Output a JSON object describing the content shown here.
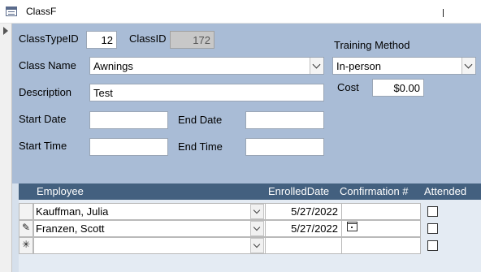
{
  "window": {
    "title": "ClassF"
  },
  "form": {
    "class_type_id_label": "ClassTypeID",
    "class_type_id_value": "12",
    "class_id_label": "ClassID",
    "class_id_value": "172",
    "class_name_label": "Class Name",
    "class_name_value": "Awnings",
    "description_label": "Description",
    "description_value": "Test",
    "start_date_label": "Start Date",
    "start_date_value": "",
    "end_date_label": "End Date",
    "end_date_value": "",
    "start_time_label": "Start Time",
    "start_time_value": "",
    "end_time_label": "End Time",
    "end_time_value": "",
    "training_method_label": "Training Method",
    "training_method_value": "In-person",
    "cost_label": "Cost",
    "cost_value": "$0.00"
  },
  "subform": {
    "columns": [
      "Employee",
      "EnrolledDate",
      "Confirmation #",
      "Attended"
    ],
    "rows": [
      {
        "selector": "",
        "employee": "Kauffman, Julia",
        "enrolled_date": "5/27/2022",
        "confirmation": "",
        "attended": false
      },
      {
        "selector": "✎",
        "employee": "Franzen, Scott",
        "enrolled_date": "5/27/2022",
        "confirmation": "",
        "attended": false
      },
      {
        "selector": "✳",
        "employee": "",
        "enrolled_date": "",
        "confirmation": "",
        "attended": false
      }
    ]
  },
  "colors": {
    "detail_background": "#a9bcd6",
    "subform_header": "#43607f"
  }
}
